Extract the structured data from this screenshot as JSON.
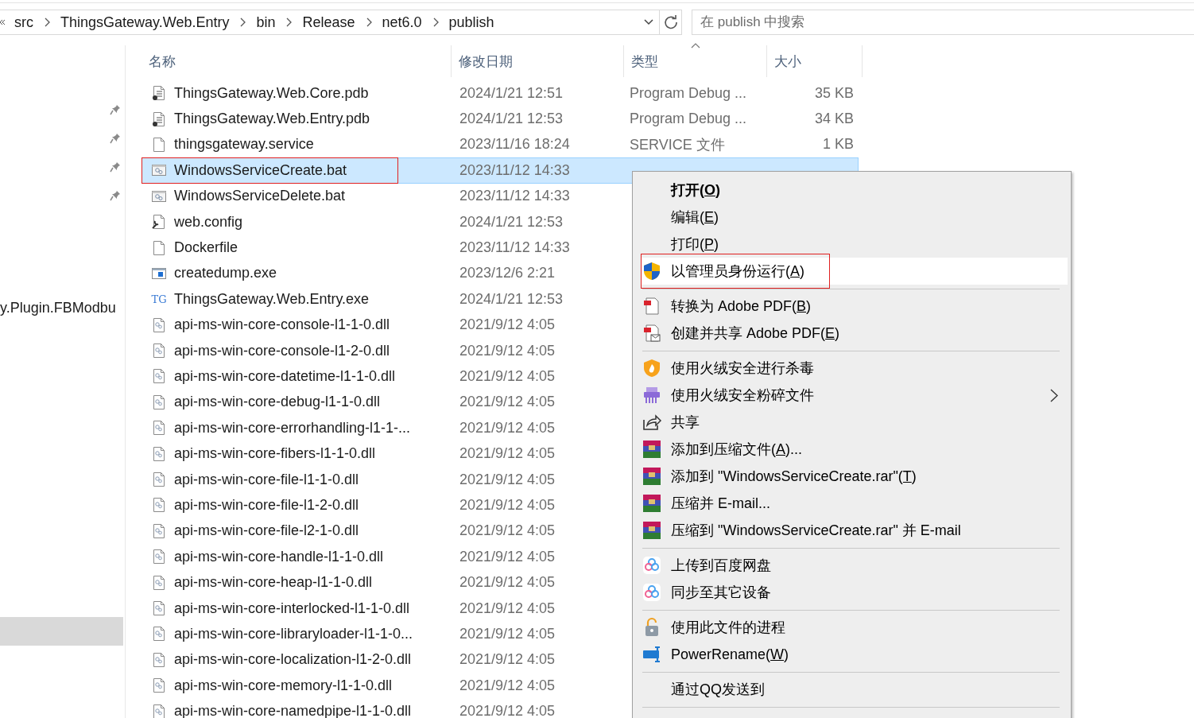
{
  "address_bar": {
    "path": [
      "src",
      "ThingsGateway.Web.Entry",
      "bin",
      "Release",
      "net6.0",
      "publish"
    ]
  },
  "search": {
    "placeholder": "在 publish 中搜索"
  },
  "nav": {
    "quick_access": [
      {
        "pinned": true
      },
      {
        "pinned": true
      },
      {
        "pinned": true
      },
      {
        "pinned": true
      }
    ],
    "items": [
      {
        "label": "y.Plugin.FBModbu",
        "selected": false
      },
      {
        "selected": true
      }
    ]
  },
  "file_list": {
    "columns": [
      {
        "label": "名称",
        "sorted": false
      },
      {
        "label": "修改日期",
        "sorted": false
      },
      {
        "label": "类型",
        "sorted": true
      },
      {
        "label": "大小",
        "sorted": false
      }
    ],
    "rows": [
      {
        "kind": "pdb",
        "name": "ThingsGateway.Web.Core.pdb",
        "date": "2024/1/21 12:51",
        "type": "Program Debug ...",
        "size": "35 KB",
        "selected": false,
        "annotated": false
      },
      {
        "kind": "pdb",
        "name": "ThingsGateway.Web.Entry.pdb",
        "date": "2024/1/21 12:53",
        "type": "Program Debug ...",
        "size": "34 KB",
        "selected": false,
        "annotated": false
      },
      {
        "kind": "blank",
        "name": "thingsgateway.service",
        "date": "2023/11/16 18:24",
        "type": "SERVICE 文件",
        "size": "1 KB",
        "selected": false,
        "annotated": false
      },
      {
        "kind": "bat",
        "name": "WindowsServiceCreate.bat",
        "date": "2023/11/12 14:33",
        "selected": true,
        "annotated": true
      },
      {
        "kind": "bat",
        "name": "WindowsServiceDelete.bat",
        "date": "2023/11/12 14:33",
        "selected": false,
        "annotated": false
      },
      {
        "kind": "config",
        "name": "web.config",
        "date": "2024/1/21 12:53",
        "selected": false,
        "annotated": false
      },
      {
        "kind": "blank",
        "name": "Dockerfile",
        "date": "2023/11/12 14:33",
        "selected": false,
        "annotated": false
      },
      {
        "kind": "exe",
        "name": "createdump.exe",
        "date": "2023/12/6 2:21",
        "selected": false,
        "annotated": false
      },
      {
        "kind": "app",
        "icon_text": "TG",
        "name": "ThingsGateway.Web.Entry.exe",
        "date": "2024/1/21 12:53",
        "selected": false,
        "annotated": false
      },
      {
        "kind": "dll",
        "name": "api-ms-win-core-console-l1-1-0.dll",
        "date": "2021/9/12 4:05",
        "selected": false,
        "annotated": false
      },
      {
        "kind": "dll",
        "name": "api-ms-win-core-console-l1-2-0.dll",
        "date": "2021/9/12 4:05",
        "selected": false,
        "annotated": false
      },
      {
        "kind": "dll",
        "name": "api-ms-win-core-datetime-l1-1-0.dll",
        "date": "2021/9/12 4:05",
        "selected": false,
        "annotated": false
      },
      {
        "kind": "dll",
        "name": "api-ms-win-core-debug-l1-1-0.dll",
        "date": "2021/9/12 4:05",
        "selected": false,
        "annotated": false
      },
      {
        "kind": "dll",
        "name": "api-ms-win-core-errorhandling-l1-1-...",
        "date": "2021/9/12 4:05",
        "selected": false,
        "annotated": false
      },
      {
        "kind": "dll",
        "name": "api-ms-win-core-fibers-l1-1-0.dll",
        "date": "2021/9/12 4:05",
        "selected": false,
        "annotated": false
      },
      {
        "kind": "dll",
        "name": "api-ms-win-core-file-l1-1-0.dll",
        "date": "2021/9/12 4:05",
        "selected": false,
        "annotated": false
      },
      {
        "kind": "dll",
        "name": "api-ms-win-core-file-l1-2-0.dll",
        "date": "2021/9/12 4:05",
        "selected": false,
        "annotated": false
      },
      {
        "kind": "dll",
        "name": "api-ms-win-core-file-l2-1-0.dll",
        "date": "2021/9/12 4:05",
        "selected": false,
        "annotated": false
      },
      {
        "kind": "dll",
        "name": "api-ms-win-core-handle-l1-1-0.dll",
        "date": "2021/9/12 4:05",
        "selected": false,
        "annotated": false
      },
      {
        "kind": "dll",
        "name": "api-ms-win-core-heap-l1-1-0.dll",
        "date": "2021/9/12 4:05",
        "selected": false,
        "annotated": false
      },
      {
        "kind": "dll",
        "name": "api-ms-win-core-interlocked-l1-1-0.dll",
        "date": "2021/9/12 4:05",
        "selected": false,
        "annotated": false
      },
      {
        "kind": "dll",
        "name": "api-ms-win-core-libraryloader-l1-1-0...",
        "date": "2021/9/12 4:05",
        "selected": false,
        "annotated": false
      },
      {
        "kind": "dll",
        "name": "api-ms-win-core-localization-l1-2-0.dll",
        "date": "2021/9/12 4:05",
        "selected": false,
        "annotated": false
      },
      {
        "kind": "dll",
        "name": "api-ms-win-core-memory-l1-1-0.dll",
        "date": "2021/9/12 4:05",
        "selected": false,
        "annotated": false
      },
      {
        "kind": "dll",
        "name": "api-ms-win-core-namedpipe-l1-1-0.dll",
        "date": "2021/9/12 4:05",
        "selected": false,
        "annotated": false
      }
    ]
  },
  "context_menu": {
    "items": [
      {
        "kind": "plain",
        "text": "打开(",
        "key": "O",
        "after": ")",
        "bold": true,
        "highlighted": false,
        "annotated": false,
        "submenu": false
      },
      {
        "kind": "plain",
        "text": "编辑(",
        "key": "E",
        "after": ")",
        "bold": false,
        "highlighted": false,
        "annotated": false,
        "submenu": false
      },
      {
        "kind": "plain",
        "text": "打印(",
        "key": "P",
        "after": ")",
        "bold": false,
        "highlighted": false,
        "annotated": false,
        "submenu": false
      },
      {
        "kind": "shield",
        "text": "以管理员身份运行(",
        "key": "A",
        "after": ")",
        "bold": false,
        "highlighted": true,
        "annotated": true,
        "submenu": false
      },
      {
        "kind": "separator"
      },
      {
        "kind": "pdf",
        "text": "转换为 Adobe PDF(",
        "key": "B",
        "after": ")",
        "bold": false,
        "highlighted": false,
        "annotated": false,
        "submenu": false
      },
      {
        "kind": "pdf-mail",
        "text": "创建并共享 Adobe PDF(",
        "key": "E",
        "after": ")",
        "bold": false,
        "highlighted": false,
        "annotated": false,
        "submenu": false
      },
      {
        "kind": "separator"
      },
      {
        "kind": "flame-shield",
        "text": "使用火绒安全进行杀毒",
        "bold": false,
        "highlighted": false,
        "annotated": false,
        "submenu": false
      },
      {
        "kind": "shredder",
        "text": "使用火绒安全粉碎文件",
        "bold": false,
        "highlighted": false,
        "annotated": false,
        "submenu": true
      },
      {
        "kind": "share",
        "text": "共享",
        "bold": false,
        "highlighted": false,
        "annotated": false,
        "submenu": false
      },
      {
        "kind": "archive",
        "text": "添加到压缩文件(",
        "key": "A",
        "after": ")...",
        "bold": false,
        "highlighted": false,
        "annotated": false,
        "submenu": false
      },
      {
        "kind": "archive",
        "text": "添加到 \"WindowsServiceCreate.rar\"(",
        "key": "T",
        "after": ")",
        "bold": false,
        "highlighted": false,
        "annotated": false,
        "submenu": false
      },
      {
        "kind": "archive",
        "text": "压缩并 E-mail...",
        "bold": false,
        "highlighted": false,
        "annotated": false,
        "submenu": false
      },
      {
        "kind": "archive",
        "text": "压缩到 \"WindowsServiceCreate.rar\" 并 E-mail",
        "bold": false,
        "highlighted": false,
        "annotated": false,
        "submenu": false
      },
      {
        "kind": "separator"
      },
      {
        "kind": "cloud",
        "text": "上传到百度网盘",
        "bold": false,
        "highlighted": false,
        "annotated": false,
        "submenu": false
      },
      {
        "kind": "cloud",
        "text": "同步至其它设备",
        "bold": false,
        "highlighted": false,
        "annotated": false,
        "submenu": false
      },
      {
        "kind": "separator"
      },
      {
        "kind": "lock",
        "text": "使用此文件的进程",
        "bold": false,
        "highlighted": false,
        "annotated": false,
        "submenu": false
      },
      {
        "kind": "rename",
        "text": "PowerRename(",
        "key": "W",
        "after": ")",
        "bold": false,
        "highlighted": false,
        "annotated": false,
        "submenu": false
      },
      {
        "kind": "separator"
      },
      {
        "kind": "plain",
        "text": "通过QQ发送到",
        "bold": false,
        "highlighted": false,
        "annotated": false,
        "submenu": false
      },
      {
        "kind": "separator"
      }
    ]
  }
}
